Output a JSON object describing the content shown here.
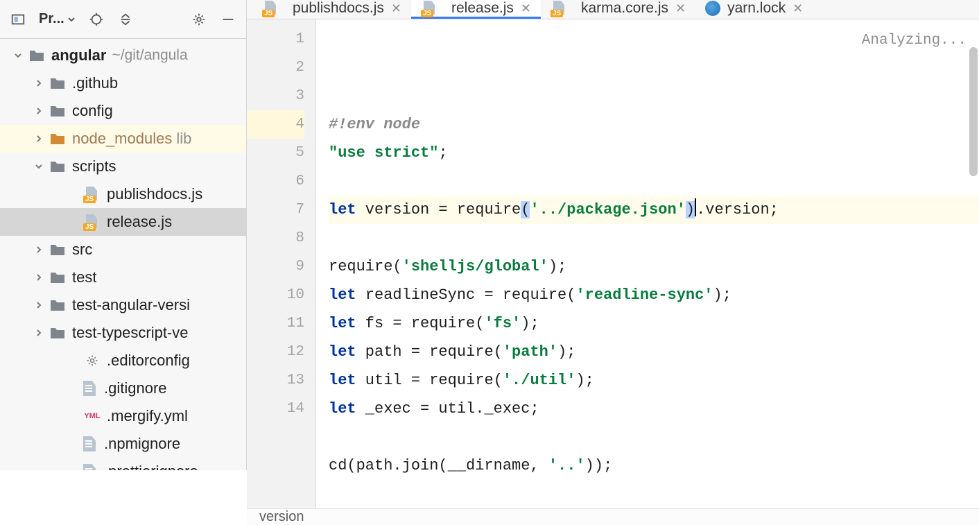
{
  "sideToolbar": {
    "projectsLabel": "Pr..."
  },
  "tree": [
    {
      "depth": 0,
      "name": "angular",
      "pathHint": "~/git/angula",
      "bold": true,
      "icon": "folder",
      "expand": "down",
      "rowClass": ""
    },
    {
      "depth": 1,
      "name": ".github",
      "icon": "folder",
      "expand": "right"
    },
    {
      "depth": 1,
      "name": "config",
      "icon": "folder",
      "expand": "right"
    },
    {
      "depth": 1,
      "name": "node_modules",
      "icon": "folder-orange",
      "expand": "right",
      "rowClass": "highlight-soft",
      "libHint": "lib",
      "labelClass": "excluded"
    },
    {
      "depth": 1,
      "name": "scripts",
      "icon": "folder",
      "expand": "down"
    },
    {
      "depth": 3,
      "name": "publishdocs.js",
      "icon": "js",
      "expand": ""
    },
    {
      "depth": 3,
      "name": "release.js",
      "icon": "js",
      "expand": "",
      "rowClass": "selected"
    },
    {
      "depth": 1,
      "name": "src",
      "icon": "folder",
      "expand": "right"
    },
    {
      "depth": 1,
      "name": "test",
      "icon": "folder",
      "expand": "right"
    },
    {
      "depth": 1,
      "name": "test-angular-versi",
      "icon": "folder",
      "expand": "right"
    },
    {
      "depth": 1,
      "name": "test-typescript-ve",
      "icon": "folder",
      "expand": "right"
    },
    {
      "depth": 3,
      "name": ".editorconfig",
      "icon": "gear",
      "expand": ""
    },
    {
      "depth": 3,
      "name": ".gitignore",
      "icon": "txt",
      "expand": ""
    },
    {
      "depth": 3,
      "name": ".mergify.yml",
      "icon": "yml",
      "expand": ""
    },
    {
      "depth": 3,
      "name": ".npmignore",
      "icon": "txt",
      "expand": ""
    },
    {
      "depth": 3,
      "name": ".prettierignore",
      "icon": "txt",
      "expand": ""
    }
  ],
  "tabs": [
    {
      "name": "publishdocs.js",
      "icon": "js",
      "active": false
    },
    {
      "name": "release.js",
      "icon": "js",
      "active": true
    },
    {
      "name": "karma.core.js",
      "icon": "js",
      "active": false
    },
    {
      "name": "yarn.lock",
      "icon": "yarn",
      "active": false
    }
  ],
  "editor": {
    "analyzing": "Analyzing...",
    "lines": [
      {
        "n": 1,
        "tokens": [
          {
            "t": "#!env node",
            "c": "tok-comment"
          }
        ]
      },
      {
        "n": 2,
        "tokens": [
          {
            "t": "\"use strict\"",
            "c": "tok-str"
          },
          {
            "t": ";"
          }
        ]
      },
      {
        "n": 3,
        "tokens": []
      },
      {
        "n": 4,
        "hl": true,
        "tokens": [
          {
            "t": "let",
            "c": "tok-kw"
          },
          {
            "t": " version = require"
          },
          {
            "t": "(",
            "c": "paren-hl"
          },
          {
            "t": "'../package.json'",
            "c": "tok-str"
          },
          {
            "t": ")",
            "c": "paren-hl"
          },
          {
            "caret": true
          },
          {
            "t": ".version;"
          }
        ]
      },
      {
        "n": 5,
        "tokens": []
      },
      {
        "n": 6,
        "tokens": [
          {
            "t": "require("
          },
          {
            "t": "'shelljs/global'",
            "c": "tok-str"
          },
          {
            "t": ");"
          }
        ]
      },
      {
        "n": 7,
        "tokens": [
          {
            "t": "let",
            "c": "tok-kw"
          },
          {
            "t": " readlineSync = require("
          },
          {
            "t": "'readline-sync'",
            "c": "tok-str"
          },
          {
            "t": ");"
          }
        ]
      },
      {
        "n": 8,
        "tokens": [
          {
            "t": "let",
            "c": "tok-kw"
          },
          {
            "t": " fs = require("
          },
          {
            "t": "'fs'",
            "c": "tok-str"
          },
          {
            "t": ");"
          }
        ]
      },
      {
        "n": 9,
        "tokens": [
          {
            "t": "let",
            "c": "tok-kw"
          },
          {
            "t": " path = require("
          },
          {
            "t": "'path'",
            "c": "tok-str"
          },
          {
            "t": ");"
          }
        ]
      },
      {
        "n": 10,
        "tokens": [
          {
            "t": "let",
            "c": "tok-kw"
          },
          {
            "t": " util = require("
          },
          {
            "t": "'./util'",
            "c": "tok-str"
          },
          {
            "t": ");"
          }
        ]
      },
      {
        "n": 11,
        "tokens": [
          {
            "t": "let",
            "c": "tok-kw"
          },
          {
            "t": " _exec = util._exec;"
          }
        ]
      },
      {
        "n": 12,
        "tokens": []
      },
      {
        "n": 13,
        "tokens": [
          {
            "t": "cd(path.join(__dirname, "
          },
          {
            "t": "'..'",
            "c": "tok-str"
          },
          {
            "t": "));"
          }
        ]
      },
      {
        "n": 14,
        "tokens": []
      }
    ],
    "breadcrumb": "version"
  }
}
